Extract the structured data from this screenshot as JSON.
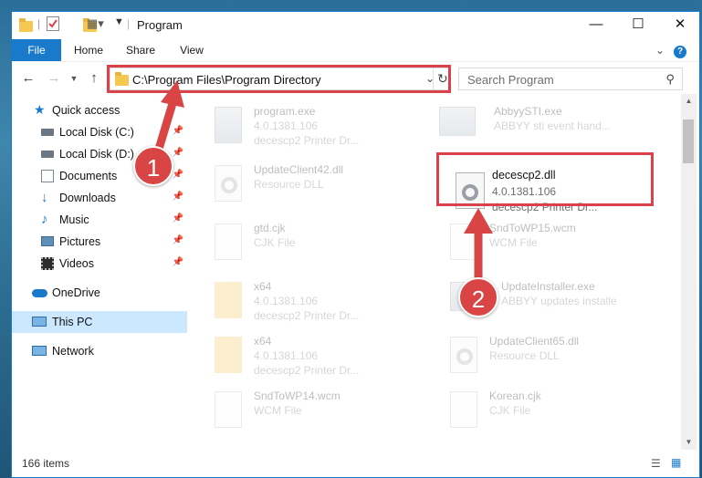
{
  "window": {
    "title": "Program"
  },
  "ribbon": {
    "tabs": [
      "File",
      "Home",
      "Share",
      "View"
    ]
  },
  "address": {
    "path": "C:\\Program Files\\Program Directory"
  },
  "search": {
    "placeholder": "Search Program"
  },
  "sidebar": {
    "items": [
      {
        "label": "Quick access",
        "icon": "star-icon",
        "pinned": false
      },
      {
        "label": "Local Disk (C:)",
        "icon": "drive-icon",
        "pinned": true
      },
      {
        "label": "Local Disk (D:)",
        "icon": "drive-icon",
        "pinned": true
      },
      {
        "label": "Documents",
        "icon": "documents-icon",
        "pinned": true
      },
      {
        "label": "Downloads",
        "icon": "download-icon",
        "pinned": true
      },
      {
        "label": "Music",
        "icon": "music-icon",
        "pinned": true
      },
      {
        "label": "Pictures",
        "icon": "pictures-icon",
        "pinned": true
      },
      {
        "label": "Videos",
        "icon": "videos-icon",
        "pinned": true
      },
      {
        "label": "OneDrive",
        "icon": "cloud-icon",
        "pinned": false
      },
      {
        "label": "This PC",
        "icon": "computer-icon",
        "pinned": false,
        "selected": true
      },
      {
        "label": "Network",
        "icon": "network-icon",
        "pinned": false
      }
    ]
  },
  "files": [
    {
      "name": "program.exe",
      "line1": "4.0.1381.106",
      "line2": "decescp2 Printer Dr...",
      "icon": "exe"
    },
    {
      "name": "AbbyySTI.exe",
      "line1": "ABBYY sti event hand...",
      "line2": "",
      "icon": "exe"
    },
    {
      "name": "UpdateClient42.dll",
      "line1": "Resource DLL",
      "line2": "",
      "icon": "dll"
    },
    {
      "name": "decescp2.dll",
      "line1": "4.0.1381.106",
      "line2": "decescp2 Printer Dr...",
      "icon": "dll"
    },
    {
      "name": "gtd.cjk",
      "line1": "CJK File",
      "line2": "",
      "icon": "doc"
    },
    {
      "name": "SndToWP15.wcm",
      "line1": "WCM File",
      "line2": "",
      "icon": "doc"
    },
    {
      "name": "x64",
      "line1": "4.0.1381.106",
      "line2": "decescp2 Printer Dr...",
      "icon": "folder"
    },
    {
      "name": "UpdateInstaller.exe",
      "line1": "ABBYY updates installe",
      "line2": "",
      "icon": "exe"
    },
    {
      "name": "x64",
      "line1": "4.0.1381.106",
      "line2": "decescp2 Printer Dr...",
      "icon": "folder"
    },
    {
      "name": "UpdateClient65.dll",
      "line1": "Resource DLL",
      "line2": "",
      "icon": "dll"
    },
    {
      "name": "SndToWP14.wcm",
      "line1": "WCM File",
      "line2": "",
      "icon": "doc"
    },
    {
      "name": "Korean.cjk",
      "line1": "CJK File",
      "line2": "",
      "icon": "doc"
    }
  ],
  "status": {
    "count": "166 items"
  },
  "annotations": {
    "step1": "1",
    "step2": "2"
  },
  "colors": {
    "accent": "#1979ca",
    "highlight": "#d9424b",
    "badge": "#d94545"
  }
}
